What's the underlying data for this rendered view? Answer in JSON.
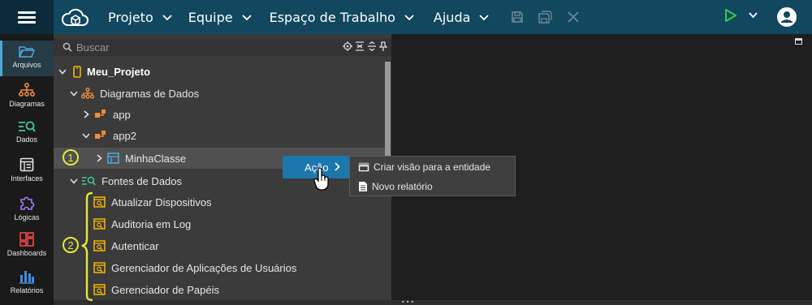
{
  "header": {
    "menus": [
      {
        "label": "Projeto"
      },
      {
        "label": "Equipe"
      },
      {
        "label": "Espaço de Trabalho"
      },
      {
        "label": "Ajuda"
      }
    ]
  },
  "sidebar": {
    "items": [
      {
        "label": "Arquivos",
        "icon": "folder-icon",
        "active": true
      },
      {
        "label": "Diagramas",
        "icon": "diagram-icon"
      },
      {
        "label": "Dados",
        "icon": "data-icon"
      },
      {
        "label": "Interfaces",
        "icon": "interfaces-icon"
      },
      {
        "label": "Lógicas",
        "icon": "puzzle-icon"
      },
      {
        "label": "Dashboards",
        "icon": "dashboard-icon"
      },
      {
        "label": "Relatórios",
        "icon": "reports-icon"
      }
    ]
  },
  "explorer": {
    "search_placeholder": "Buscar",
    "tree": [
      {
        "label": "Meu_Projeto",
        "level": 0
      },
      {
        "label": "Diagramas de Dados",
        "level": 1
      },
      {
        "label": "app",
        "level": 2
      },
      {
        "label": "app2",
        "level": 2
      },
      {
        "label": "MinhaClasse",
        "level": 3,
        "selected": true
      },
      {
        "label": "Fontes de Dados",
        "level": 1
      },
      {
        "label": "Atualizar Dispositivos",
        "level": 2
      },
      {
        "label": "Auditoria em Log",
        "level": 2
      },
      {
        "label": "Autenticar",
        "level": 2
      },
      {
        "label": "Gerenciador de Aplicações de Usuários",
        "level": 2
      },
      {
        "label": "Gerenciador de Papéis",
        "level": 2
      }
    ]
  },
  "context_menu": {
    "label": "Ação",
    "items": [
      {
        "label": "Criar visão para a entidade",
        "icon": "window-icon"
      },
      {
        "label": "Novo relatório",
        "icon": "document-icon"
      }
    ]
  },
  "annotations": {
    "badge_1": "1",
    "badge_2": "2",
    "color": "#e4ea3c"
  },
  "colors": {
    "topbar": "#11475f",
    "accent": "#1c77ad",
    "panel": "#3b3b3b",
    "rail": "#1a1a1a"
  }
}
